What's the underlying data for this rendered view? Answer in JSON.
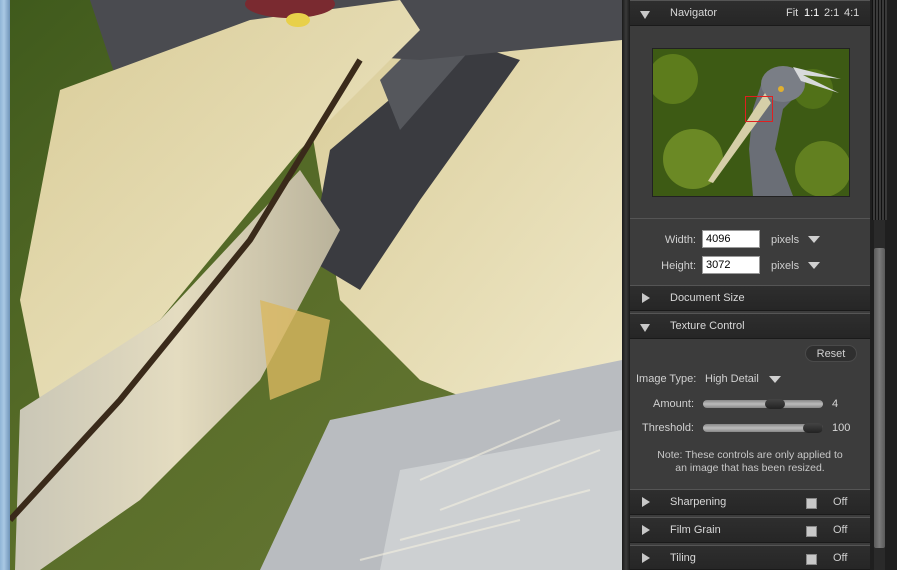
{
  "navigator": {
    "title": "Navigator",
    "zoom_options": [
      "Fit",
      "1:1",
      "2:1",
      "4:1"
    ],
    "active_zoom": "1:1"
  },
  "image_size": {
    "width_label": "Width:",
    "width_value": "4096",
    "width_unit": "pixels",
    "height_label": "Height:",
    "height_value": "3072",
    "height_unit": "pixels"
  },
  "document_size": {
    "title": "Document Size"
  },
  "texture_control": {
    "title": "Texture Control",
    "reset_label": "Reset",
    "image_type_label": "Image Type:",
    "image_type_value": "High Detail",
    "amount_label": "Amount:",
    "amount_value": "4",
    "threshold_label": "Threshold:",
    "threshold_value": "100",
    "note_line1": "Note: These controls are only applied to",
    "note_line2": "an image that has been resized."
  },
  "sharpening": {
    "title": "Sharpening",
    "state": "Off"
  },
  "film_grain": {
    "title": "Film Grain",
    "state": "Off"
  },
  "tiling": {
    "title": "Tiling",
    "state": "Off"
  }
}
